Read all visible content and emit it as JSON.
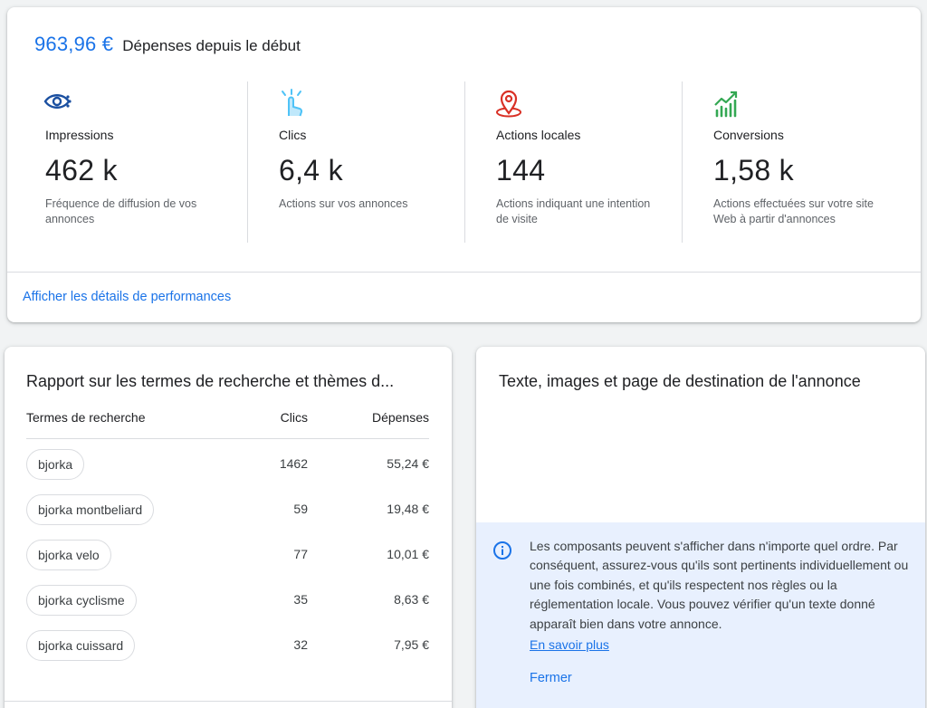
{
  "summary": {
    "spend_amount": "963,96 €",
    "spend_label": "Dépenses depuis le début",
    "metrics": [
      {
        "icon": "eye-icon",
        "title": "Impressions",
        "value": "462 k",
        "description": "Fréquence de diffusion de vos annonces"
      },
      {
        "icon": "tap-icon",
        "title": "Clics",
        "value": "6,4 k",
        "description": "Actions sur vos annonces"
      },
      {
        "icon": "location-pin-icon",
        "title": "Actions locales",
        "value": "144",
        "description": "Actions indiquant une intention de visite"
      },
      {
        "icon": "trending-chart-icon",
        "title": "Conversions",
        "value": "1,58 k",
        "description": "Actions effectuées sur votre site Web à partir d'annonces"
      }
    ],
    "performance_link": "Afficher les détails de performances"
  },
  "search_terms": {
    "title": "Rapport sur les termes de recherche et thèmes d...",
    "columns": [
      "Termes de recherche",
      "Clics",
      "Dépenses"
    ],
    "rows": [
      {
        "term": "bjorka",
        "clicks": "1462",
        "spend": "55,24 €"
      },
      {
        "term": "bjorka montbeliard",
        "clicks": "59",
        "spend": "19,48 €"
      },
      {
        "term": "bjorka velo",
        "clicks": "77",
        "spend": "10,01 €"
      },
      {
        "term": "bjorka cyclisme",
        "clicks": "35",
        "spend": "8,63 €"
      },
      {
        "term": "bjorka cuissard",
        "clicks": "32",
        "spend": "7,95 €"
      }
    ]
  },
  "ad_assets": {
    "title": "Texte, images et page de destination de l'annonce",
    "info_text": "Les composants peuvent s'afficher dans n'importe quel ordre. Par conséquent, assurez-vous qu'ils sont pertinents individuellement ou une fois combinés, et qu'ils respectent nos règles ou la réglementation locale. Vous pouvez vérifier qu'un texte donné apparaît bien dans votre annonce.",
    "learn_more": "En savoir plus",
    "close": "Fermer"
  },
  "colors": {
    "accent": "#1a73e8",
    "eye_icon": "#1a4fa0",
    "tap_icon": "#4fc3f7",
    "pin_icon": "#d93025",
    "chart_icon": "#34a853",
    "info_bg": "#e8f0fe"
  }
}
